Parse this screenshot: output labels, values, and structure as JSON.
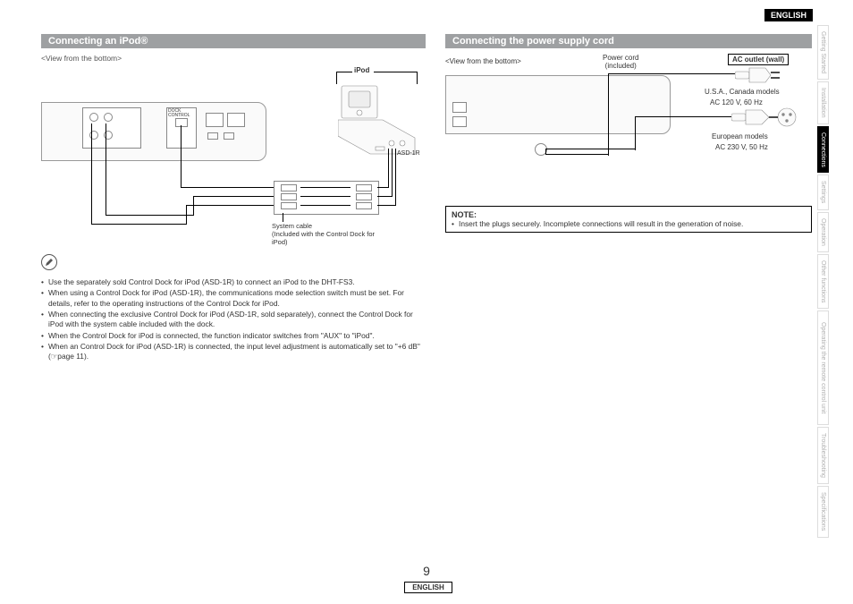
{
  "language_top": "ENGLISH",
  "language_bottom": "ENGLISH",
  "page_number": "9",
  "side_tabs": [
    {
      "label": "Getting Started",
      "active": false
    },
    {
      "label": "Installation",
      "active": false
    },
    {
      "label": "Connections",
      "active": true
    },
    {
      "label": "Settings",
      "active": false
    },
    {
      "label": "Operation",
      "active": false
    },
    {
      "label": "Other functions",
      "active": false
    },
    {
      "label": "Operating the remote control unit",
      "active": false
    },
    {
      "label": "Troubleshooting",
      "active": false
    },
    {
      "label": "Specifications",
      "active": false
    }
  ],
  "left": {
    "header": "Connecting an iPod®",
    "view_caption": "<View from the bottom>",
    "ipod_label": "iPod",
    "asd_label": "ASD-1R",
    "dock_control_label": "DOCK\nCONTROL",
    "system_cable_label": "System cable\n(Included with the Control Dock for iPod)",
    "note_icon": "pencil",
    "bullets": [
      "Use the separately sold Control Dock for iPod (ASD-1R) to connect an iPod to the DHT-FS3.",
      "When using a Control Dock for iPod (ASD-1R), the communications mode selection switch must be set. For details, refer to the operating instructions of the Control Dock for iPod.",
      "When connecting the exclusive Control Dock for iPod (ASD-1R, sold separately), connect the Control Dock for iPod with the system cable included with the dock.",
      "When the Control Dock for iPod is connected, the function indicator switches from \"AUX\" to \"iPod\".",
      "When an Control Dock for iPod (ASD-1R) is connected, the input level adjustment is automatically set to \"+6 dB\" (☞page 11)."
    ]
  },
  "right": {
    "header": "Connecting the power supply cord",
    "view_caption": "<View from the bottom>",
    "power_cord_label": "Power cord\n(included)",
    "ac_outlet_label": "AC outlet (wall)",
    "models_us": "U.S.A., Canada models",
    "voltage_us": "AC 120 V, 60 Hz",
    "models_eu": "European models",
    "voltage_eu": "AC 230 V, 50 Hz",
    "note_header": "NOTE:",
    "note_body": "Insert the plugs securely. Incomplete connections will result in the generation of noise."
  }
}
